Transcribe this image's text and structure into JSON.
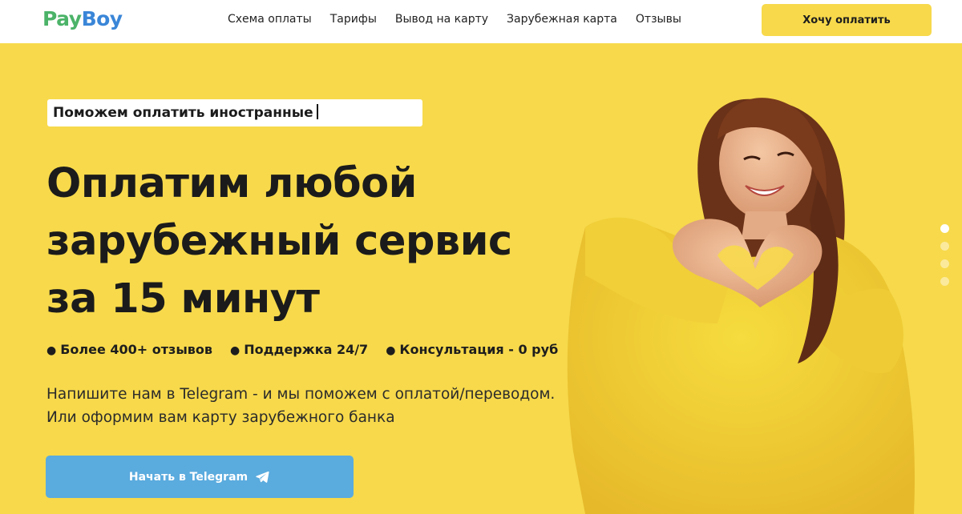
{
  "header": {
    "logo_part1": "Pay",
    "logo_part2": "Boy",
    "nav": [
      "Схема оплаты",
      "Тарифы",
      "Вывод на карту",
      "Зарубежная карта",
      "Отзывы"
    ],
    "cta_label": "Хочу оплатить"
  },
  "hero": {
    "typing_text": "Поможем оплатить иностранные",
    "headline_line1": "Оплатим любой",
    "headline_line2": "зарубежный сервис",
    "headline_line3": "за 15 минут",
    "bullets": [
      "Более 400+ отзывов",
      "Поддержка 24/7",
      "Консультация - 0 руб"
    ],
    "description_line1": "Напишите нам в Telegram - и мы поможем с оплатой/переводом.",
    "description_line2": "Или оформим вам карту зарубежного банка",
    "button_label": "Начать в Telegram",
    "button_icon": "telegram-icon"
  },
  "slider": {
    "count": 4,
    "active_index": 0
  },
  "colors": {
    "brand_yellow": "#f7d94b",
    "logo_green": "#4bb368",
    "logo_blue": "#3a86d8",
    "telegram_blue": "#5aabde"
  }
}
